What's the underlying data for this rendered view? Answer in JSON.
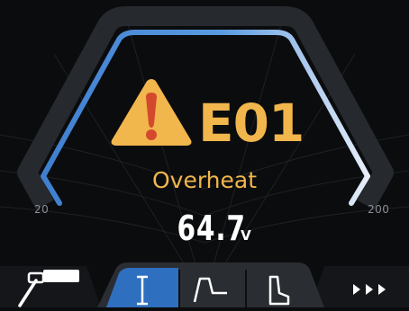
{
  "gauge": {
    "scale_min_label": "20",
    "scale_max_label": "200"
  },
  "alarm": {
    "code": "E01",
    "description": "Overheat",
    "icon": "warning-triangle-icon",
    "color": "#f1b64c"
  },
  "reading": {
    "value": "64.7",
    "unit": "V"
  },
  "toolbar": {
    "items": [
      {
        "icon": "welding-torch-icon",
        "active": false
      },
      {
        "icon": "current-mode-icon",
        "active": true
      },
      {
        "icon": "pulse-waveform-icon",
        "active": false
      },
      {
        "icon": "step-waveform-icon",
        "active": false
      },
      {
        "icon": "more-arrows-icon",
        "active": false
      }
    ]
  },
  "colors": {
    "background": "#0b0c0e",
    "gauge_arc": "#4f8fd8",
    "active_tab": "#2f6fc0",
    "text_primary": "#ffffff"
  }
}
